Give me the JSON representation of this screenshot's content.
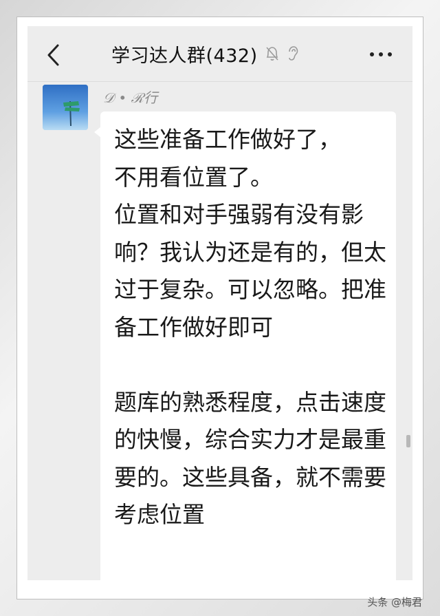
{
  "header": {
    "title": "学习达人群(432)",
    "back_icon": "chevron-left-icon",
    "mute_icon": "bell-off-icon",
    "ear_icon": "ear-icon",
    "more_icon": "more-dots-icon"
  },
  "message": {
    "sender": "𝒟 • ℛ行",
    "text": "这些准备工作做好了，\n不用看位置了。\n位置和对手强弱有没有影响？我认为还是有的，但太过于复杂。可以忽略。把准备工作做好即可\n\n题库的熟悉程度，点击速度的快慢，综合实力才是最重要的。这些具备，就不需要考虑位置"
  },
  "watermark": "头条 @梅君",
  "colors": {
    "background": "#ededed",
    "bubble": "#ffffff",
    "text": "#191919"
  }
}
